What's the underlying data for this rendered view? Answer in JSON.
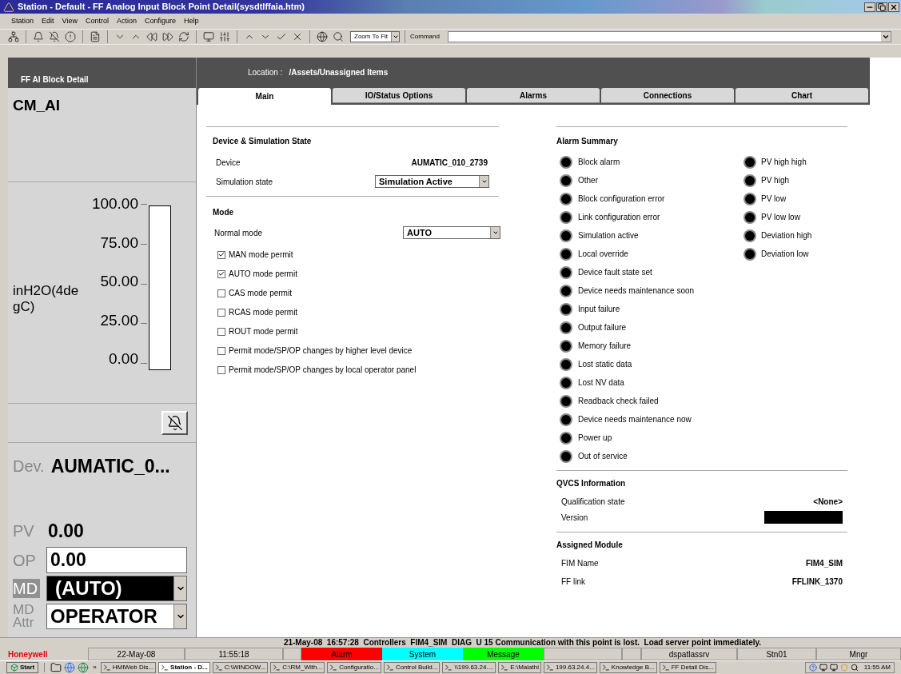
{
  "window": {
    "title": "Station - Default - FF Analog Input Block Point Detail(sysdtlffaia.htm)"
  },
  "menu": [
    "Station",
    "Edit",
    "View",
    "Control",
    "Action",
    "Configure",
    "Help"
  ],
  "toolbar": {
    "zoom": "Zoom To Fit",
    "command_label": "Command"
  },
  "left_panel": {
    "title": "FF AI Block Detail",
    "point": "CM_AI",
    "unit": "inH2O(4degC)",
    "scale": [
      "100.00",
      "75.00",
      "50.00",
      "25.00",
      "0.00"
    ],
    "bar": {
      "level": 0
    },
    "dev_label": "Dev.",
    "dev_value": "AUMATIC_0...",
    "pv_label": "PV",
    "pv_value": "0.00",
    "op_label": "OP",
    "op_value": "0.00",
    "md_label": "MD",
    "md_value": "(AUTO)",
    "attr_label": "MD Attr",
    "attr_value": "OPERATOR"
  },
  "location": {
    "label": "Location :",
    "value": "/Assets/Unassigned Items"
  },
  "tabs": [
    {
      "label": "Main",
      "selected": true
    },
    {
      "label": "IO/Status Options",
      "selected": false
    },
    {
      "label": "Alarms",
      "selected": false
    },
    {
      "label": "Connections",
      "selected": false
    },
    {
      "label": "Chart",
      "selected": false
    }
  ],
  "device_section": {
    "title": "Device & Simulation State",
    "device_label": "Device",
    "device_value": "AUMATIC_010_2739",
    "sim_label": "Simulation state",
    "sim_value": "Simulation Active"
  },
  "mode_section": {
    "title": "Mode",
    "normal_label": "Normal mode",
    "normal_value": "AUTO",
    "permits": [
      {
        "label": "MAN mode permit",
        "checked": true
      },
      {
        "label": "AUTO mode permit",
        "checked": true
      },
      {
        "label": "CAS mode permit",
        "checked": false
      },
      {
        "label": "RCAS mode permit",
        "checked": false
      },
      {
        "label": "ROUT mode permit",
        "checked": false
      },
      {
        "label": "Permit mode/SP/OP changes by higher level device",
        "checked": false
      },
      {
        "label": "Permit mode/SP/OP changes by local operator panel",
        "checked": false
      }
    ]
  },
  "alarm_summary": {
    "title": "Alarm Summary",
    "column_1": [
      "Block alarm",
      "Other",
      "Block configuration error",
      "Link configuration error",
      "Simulation active",
      "Local override",
      "Device fault state set",
      "Device needs maintenance soon",
      "Input failure",
      "Output failure",
      "Memory failure",
      "Lost static data",
      "Lost NV data",
      "Readback check failed",
      "Device needs maintenance now",
      "Power up",
      "Out of service"
    ],
    "column_2": [
      "PV high high",
      "PV high",
      "PV low",
      "PV low low",
      "Deviation high",
      "Deviation low"
    ]
  },
  "qvcs": {
    "title": "QVCS Information",
    "qualification_label": "Qualification state",
    "qualification_value": "<None>",
    "version_label": "Version"
  },
  "assigned_module": {
    "title": "Assigned Module",
    "fim_label": "FIM Name",
    "fim_value": "FIM4_SIM",
    "link_label": "FF link",
    "link_value": "FFLINK_1370"
  },
  "message_line": "21-May-08  16:57:28  Controllers  FIM4_SIM  DIAG  U 15 Communication with this point is lost.  Load server point immediately.",
  "status_bar": {
    "brand": "Honeywell",
    "date": "22-May-08",
    "time": "11:55:18",
    "cells": [
      {
        "label": "Alarm",
        "color": "#ff0000"
      },
      {
        "label": "System",
        "color": "#00ffff"
      },
      {
        "label": "Message",
        "color": "#00ff00"
      }
    ],
    "server": "dspatlassrv",
    "station": "Stn01",
    "level": "Mngr"
  },
  "taskbar": {
    "start": "Start",
    "more": "»",
    "items": [
      {
        "label": "HMIWeb Dis...",
        "selected": false
      },
      {
        "label": "Station - D...",
        "selected": true
      },
      {
        "label": "C:\\WINDOW...",
        "selected": false
      },
      {
        "label": "C:\\RM_With...",
        "selected": false
      },
      {
        "label": "Configuratio...",
        "selected": false
      },
      {
        "label": "Control Build...",
        "selected": false
      },
      {
        "label": "\\\\199.63.24....",
        "selected": false
      },
      {
        "label": "E:\\Malathi",
        "selected": false
      },
      {
        "label": "199.63.24.4...",
        "selected": false
      },
      {
        "label": "Knowledge B...",
        "selected": false
      },
      {
        "label": "FF Detail Dis...",
        "selected": false
      }
    ],
    "clock": "11:55 AM"
  }
}
